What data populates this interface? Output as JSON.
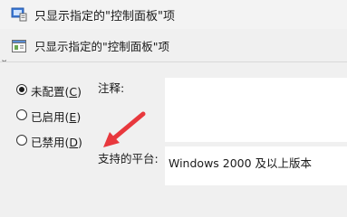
{
  "window": {
    "title": "只显示指定的\"控制面板\"项"
  },
  "policy": {
    "title": "只显示指定的\"控制面板\"项"
  },
  "state": {
    "selected": "not_configured"
  },
  "options": {
    "not_configured": {
      "text": "未配置",
      "key": "(C)",
      "access": "C"
    },
    "enabled": {
      "text": "已启用",
      "key": "(E)",
      "access": "E"
    },
    "disabled": {
      "text": "已禁用",
      "key": "(D)",
      "access": "D"
    }
  },
  "labels": {
    "comment": "注释:",
    "supported_on": "支持的平台:"
  },
  "values": {
    "supported_on": "Windows 2000 及以上版本"
  },
  "annotation": {
    "color": "#e8383d"
  }
}
